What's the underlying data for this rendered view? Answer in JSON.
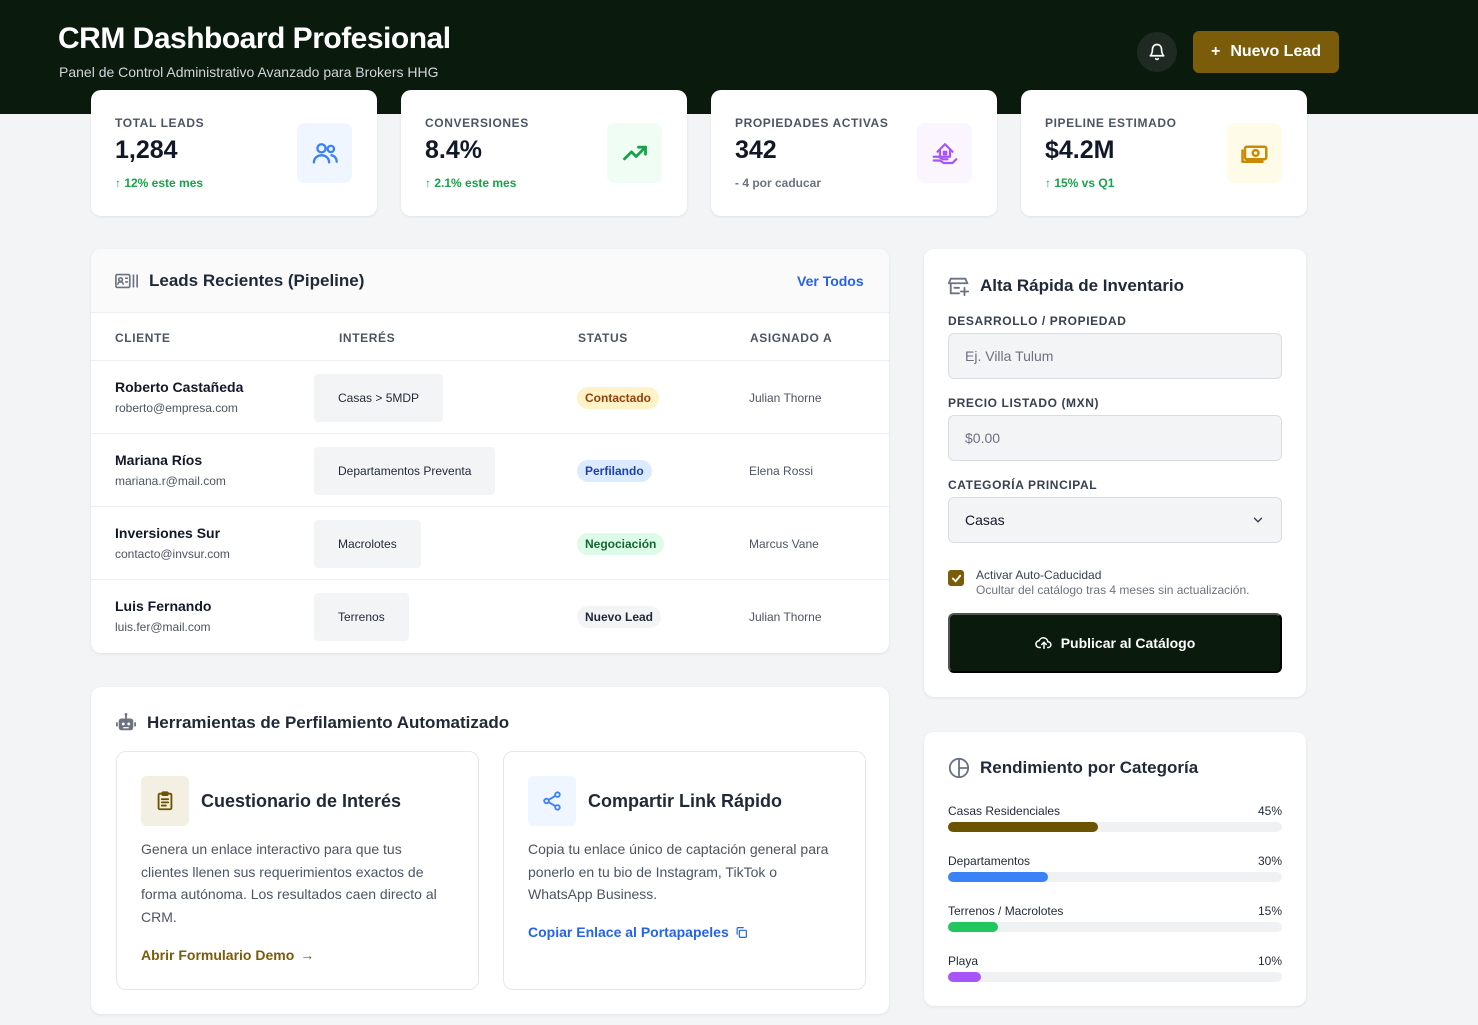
{
  "header": {
    "title": "CRM Dashboard Profesional",
    "subtitle": "Panel de Control Administrativo Avanzado para Brokers HHG",
    "new_lead_label": "Nuevo Lead",
    "new_lead_icon": "+"
  },
  "stats": [
    {
      "label": "TOTAL LEADS",
      "value": "1,284",
      "delta": "↑ 12% este mes",
      "icon": "users-icon",
      "icon_bg": "#eff6ff",
      "icon_color": "#3b82f6"
    },
    {
      "label": "CONVERSIONES",
      "value": "8.4%",
      "delta": "↑ 2.1% este mes",
      "icon": "trending-up-icon",
      "icon_bg": "#f0fdf4",
      "icon_color": "#16a34a"
    },
    {
      "label": "PROPIEDADES ACTIVAS",
      "value": "342",
      "delta": "- 4 por caducar",
      "icon": "house-hand-icon",
      "icon_bg": "#faf5ff",
      "icon_color": "#a855f7"
    },
    {
      "label": "PIPELINE ESTIMADO",
      "value": "$4.2M",
      "delta": "↑ 15% vs Q1",
      "icon": "money-icon",
      "icon_bg": "#fefce8",
      "icon_color": "#ca8a04"
    }
  ],
  "leads": {
    "title": "Leads Recientes (Pipeline)",
    "view_all": "Ver Todos",
    "columns": [
      "CLIENTE",
      "INTERÉS",
      "STATUS",
      "ASIGNADO A"
    ],
    "rows": [
      {
        "name": "Roberto Castañeda",
        "email": "roberto@empresa.com",
        "interest": "Casas > 5MDP",
        "status": "Contactado",
        "assigned": "Julian Thorne"
      },
      {
        "name": "Mariana Ríos",
        "email": "mariana.r@mail.com",
        "interest": "Departamentos Preventa",
        "status": "Perfilando",
        "assigned": "Elena Rossi"
      },
      {
        "name": "Inversiones Sur",
        "email": "contacto@invsur.com",
        "interest": "Macrolotes",
        "status": "Negociación",
        "assigned": "Marcus Vane"
      },
      {
        "name": "Luis Fernando",
        "email": "luis.fer@mail.com",
        "interest": "Terrenos",
        "status": "Nuevo Lead",
        "assigned": "Julian Thorne"
      }
    ],
    "status_colors": {
      "Contactado": {
        "bg": "#fef3c7",
        "fg": "#92400e"
      },
      "Perfilando": {
        "bg": "#dbeafe",
        "fg": "#1e40af"
      },
      "Negociación": {
        "bg": "#dcfce7",
        "fg": "#166534"
      },
      "Nuevo Lead": {
        "bg": "#f3f4f6",
        "fg": "#1f2937"
      }
    }
  },
  "tools": {
    "title": "Herramientas de Perfilamiento Automatizado",
    "cards": [
      {
        "title": "Cuestionario de Interés",
        "description": "Genera un enlace interactivo para que tus clientes llenen sus requerimientos exactos de forma autónoma. Los resultados caen directo al CRM.",
        "link": "Abrir Formulario Demo",
        "link_color": "#7a5c0a",
        "icon": "clipboard-icon"
      },
      {
        "title": "Compartir Link Rápido",
        "description": "Copia tu enlace único de captación general para ponerlo en tu bio de Instagram, TikTok o WhatsApp Business.",
        "link": "Copiar Enlace al Portapapeles",
        "link_color": "#2563eb",
        "icon": "share-icon"
      }
    ]
  },
  "inventory": {
    "title": "Alta Rápida de Inventario",
    "property_label": "DESARROLLO / PROPIEDAD",
    "property_placeholder": "Ej. Villa Tulum",
    "price_label": "PRECIO LISTADO (MXN)",
    "price_placeholder": "$0.00",
    "category_label": "CATEGORÍA PRINCIPAL",
    "category_value": "Casas",
    "auto_expire_label": "Activar Auto-Caducidad",
    "auto_expire_help": "Ocultar del catálogo tras 4 meses sin actualización.",
    "auto_expire_checked": true,
    "publish_label": "Publicar al Catálogo"
  },
  "performance": {
    "title": "Rendimiento por Categoría",
    "items": [
      {
        "label": "Casas Residenciales",
        "value": "45%",
        "fraction": 0.45,
        "color": "#6b5300"
      },
      {
        "label": "Departamentos",
        "value": "30%",
        "fraction": 0.3,
        "color": "#3b82f6"
      },
      {
        "label": "Terrenos / Macrolotes",
        "value": "15%",
        "fraction": 0.15,
        "color": "#22c55e"
      },
      {
        "label": "Playa",
        "value": "10%",
        "fraction": 0.1,
        "color": "#a855f7"
      }
    ]
  }
}
